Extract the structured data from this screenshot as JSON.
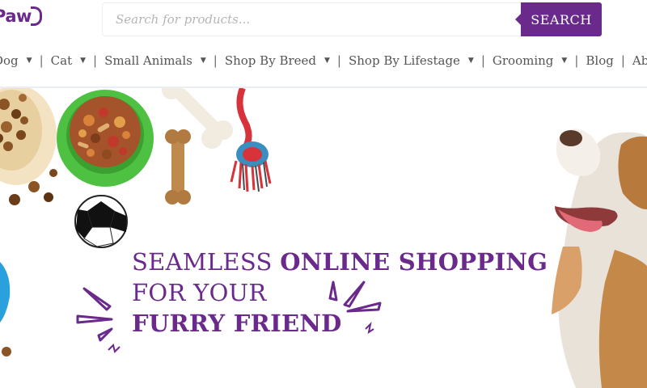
{
  "logo": {
    "text": "Paw"
  },
  "search": {
    "placeholder": "Search for products...",
    "button_label": "SEARCH"
  },
  "nav": {
    "items": [
      {
        "label": "Dog",
        "has_dropdown": true
      },
      {
        "label": "Cat",
        "has_dropdown": true
      },
      {
        "label": "Small Animals",
        "has_dropdown": true
      },
      {
        "label": "Shop By Breed",
        "has_dropdown": true
      },
      {
        "label": "Shop By Lifestage",
        "has_dropdown": true
      },
      {
        "label": "Grooming",
        "has_dropdown": true
      },
      {
        "label": "Blog",
        "has_dropdown": false
      },
      {
        "label": "About",
        "has_dropdown": false
      }
    ],
    "dropdown_glyph": "▼",
    "separator": "|"
  },
  "hero": {
    "line1_light": "SEAMLESS ",
    "line1_bold": "ONLINE SHOPPING",
    "line2_light": "FOR YOUR",
    "line3_bold": "FURRY FRIEND"
  },
  "colors": {
    "brand": "#6a2a8c",
    "text": "#555555",
    "bowl_green": "#4fc142",
    "bowl_cream": "#f3e3c2",
    "rope_red": "#d8323b"
  }
}
